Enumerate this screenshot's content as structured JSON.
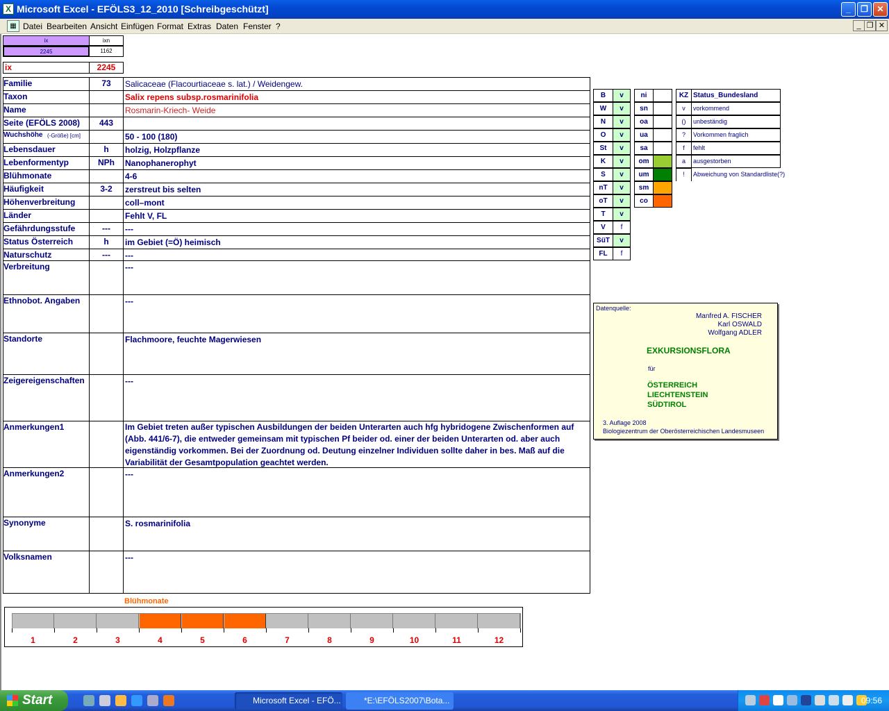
{
  "window": {
    "title": "Microsoft Excel - EFÖLS3_12_2010  [Schreibgeschützt]",
    "app_icon": "X"
  },
  "menu": [
    "Datei",
    "Bearbeiten",
    "Ansicht",
    "Einfügen",
    "Format",
    "Extras",
    "Daten",
    "Fenster",
    "?"
  ],
  "header_cells": {
    "ix_label": "ix",
    "ixn_label": "ixn",
    "ix_value": "2245",
    "ixn_value": "1162",
    "ix_big_label": "ix",
    "ix_big_value": "2245"
  },
  "fields": [
    {
      "label": "Familie",
      "code": "73",
      "value": "Salicaceae (Flacourtiaceae s. lat.)  /  Weidengew."
    },
    {
      "label": "Taxon",
      "code": "",
      "value": "Salix repens subsp.rosmarinifolia"
    },
    {
      "label": "Name",
      "code": "",
      "value": "Rosmarin-Kriech- Weide"
    },
    {
      "label": "Seite (EFÖLS 2008)",
      "code": "443",
      "value": ""
    },
    {
      "label": "Wuchshöhe",
      "label_suffix": "(-Größe) [cm]",
      "code": "",
      "value": " 50 - 100 (180)"
    },
    {
      "label": "Lebensdauer",
      "code": "h",
      "value": "holzig, Holzpflanze"
    },
    {
      "label": "Lebenformentyp",
      "code": "NPh",
      "value": "Nanophanerophyt"
    },
    {
      "label": "Blühmonate",
      "code": "",
      "value": " 4-6"
    },
    {
      "label": "Häufigkeit",
      "code": "3-2",
      "value": "zerstreut bis selten"
    },
    {
      "label": "Höhenverbreitung",
      "code": "",
      "value": "coll–mont"
    },
    {
      "label": "Länder",
      "code": "",
      "value": "Fehlt V, FL"
    },
    {
      "label": "Gefährdungsstufe",
      "code": "---",
      "value": "  ---"
    },
    {
      "label": "Status Österreich",
      "code": "h",
      "value": "im Gebiet (=Ö) heimisch"
    },
    {
      "label": "Naturschutz",
      "code": "---",
      "value": " ---"
    },
    {
      "label": "Verbreitung",
      "code": "",
      "value": " ---"
    },
    {
      "label": "Ethnobot. Angaben",
      "code": "",
      "value": "---"
    },
    {
      "label": "Standorte",
      "code": "",
      "value": "Flachmoore, feuchte Magerwiesen"
    },
    {
      "label": "Zeigereigenschaften",
      "code": "",
      "value": "---"
    },
    {
      "label": "Anmerkungen1",
      "code": "",
      "value_lines": [
        "Im Gebiet treten außer typischen Ausbildungen der beiden Unterarten auch hfg hybridogene Zwischenformen auf",
        "(Abb. 441/6-7), die entweder gemeinsam mit typischen Pf beider od. einer der beiden Unterarten od. aber auch",
        "eigenständig vorkommen. Bei der Zuordnung od. Deutung einzelner Individuen sollte daher in bes. Maß auf die",
        "Variabilität der Gesamtpopulation geachtet werden."
      ]
    },
    {
      "label": "Anmerkungen2",
      "code": "",
      "value": "---"
    },
    {
      "label": "Synonyme",
      "code": "",
      "value": "S. rosmarinifolia"
    },
    {
      "label": "Volksnamen",
      "code": "",
      "value": "---"
    }
  ],
  "states": [
    {
      "code": "B",
      "v": "v"
    },
    {
      "code": "W",
      "v": "v"
    },
    {
      "code": "N",
      "v": "v"
    },
    {
      "code": "O",
      "v": "v"
    },
    {
      "code": "St",
      "v": "v"
    },
    {
      "code": "K",
      "v": "v"
    },
    {
      "code": "S",
      "v": "v"
    },
    {
      "code": "nT",
      "v": "v"
    },
    {
      "code": "oT",
      "v": "v"
    },
    {
      "code": "T",
      "v": "v"
    },
    {
      "code": "V",
      "v": "f"
    },
    {
      "code": "SüT",
      "v": "v"
    },
    {
      "code": "FL",
      "v": "f"
    }
  ],
  "altitude": [
    {
      "code": "ni",
      "color": ""
    },
    {
      "code": "sn",
      "color": ""
    },
    {
      "code": "oa",
      "color": ""
    },
    {
      "code": "ua",
      "color": ""
    },
    {
      "code": "sa",
      "color": ""
    },
    {
      "code": "om",
      "color": "#9acd32"
    },
    {
      "code": "um",
      "color": "#008000"
    },
    {
      "code": "sm",
      "color": "#ffa500"
    },
    {
      "code": "co",
      "color": "#ff6600"
    }
  ],
  "legend": {
    "header_kz": "KZ",
    "header_status": "Status_Bundesland",
    "items": [
      {
        "kz": "v",
        "text": "vorkommend"
      },
      {
        "kz": "()",
        "text": "unbeständig"
      },
      {
        "kz": "?",
        "text": "Vorkommen fraglich"
      },
      {
        "kz": "f",
        "text": "fehlt"
      },
      {
        "kz": "a",
        "text": "ausgestorben"
      },
      {
        "kz": "!",
        "text": "Abweichung von Standardliste(?)"
      }
    ]
  },
  "source": {
    "label": "Datenquelle:",
    "authors": [
      "Manfred A. FISCHER",
      "Karl OSWALD",
      "Wolfgang ADLER"
    ],
    "title": "EXKURSIONSFLORA",
    "fuer": "für",
    "countries": [
      "ÖSTERREICH",
      "LIECHTENSTEIN",
      "SÜDTIROL"
    ],
    "edition": "3. Auflage 2008",
    "publisher": "Biologiezentrum der Oberösterreichischen Landesmuseen"
  },
  "bloom_chart": {
    "title": "Blühmonate",
    "months": [
      "1",
      "2",
      "3",
      "4",
      "5",
      "6",
      "7",
      "8",
      "9",
      "10",
      "11",
      "12"
    ],
    "active": [
      4,
      5,
      6
    ],
    "active_color": "#ff6600",
    "inactive_color": "#c0c0c0"
  },
  "taskbar": {
    "start": "Start",
    "buttons": [
      "Microsoft Excel - EFÖ...",
      "*E:\\EFÖLS2007\\Bota..."
    ],
    "clock": "09:56"
  }
}
